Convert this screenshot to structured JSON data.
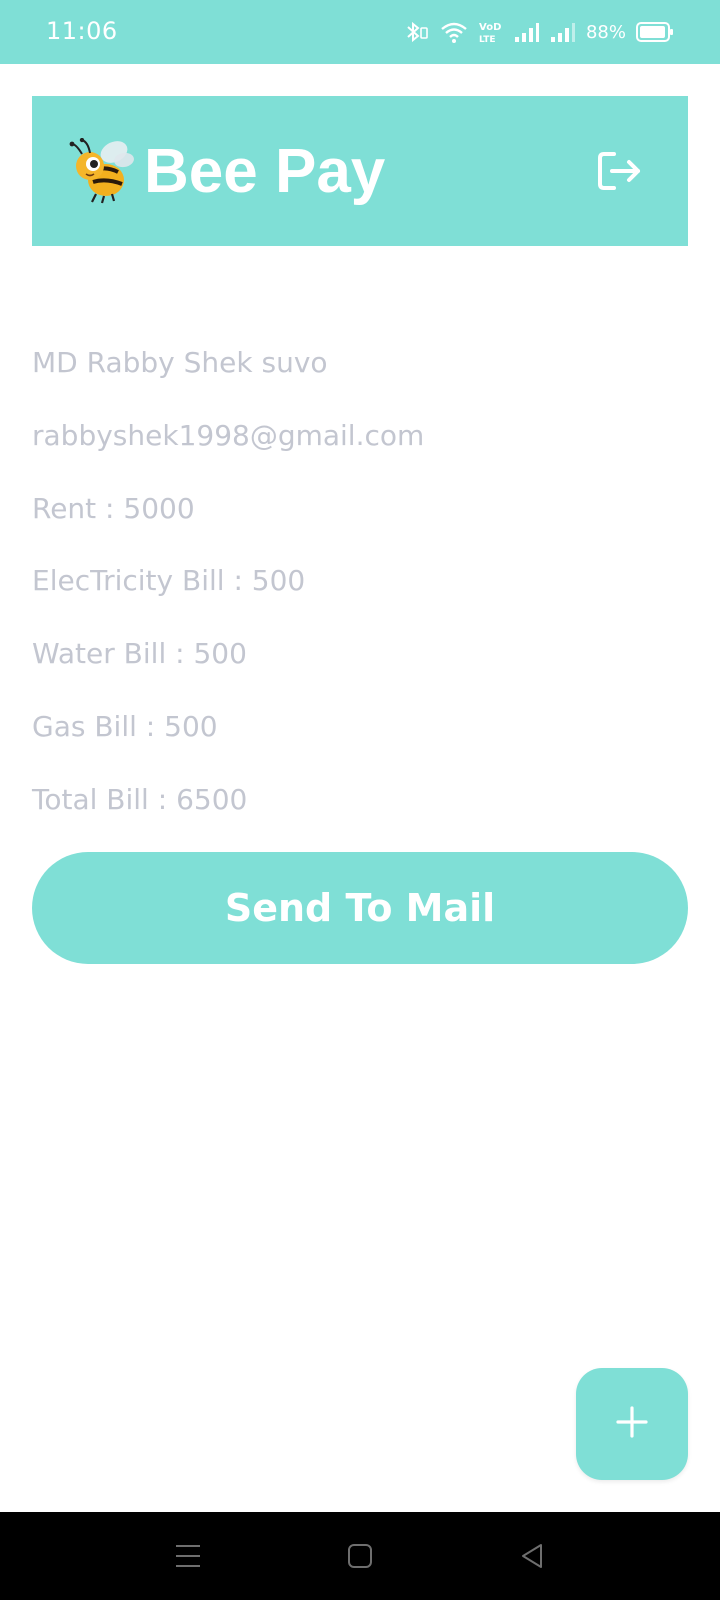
{
  "status_bar": {
    "time": "11:06",
    "battery": "88%",
    "icons": [
      "bluetooth-icon",
      "wifi-icon",
      "volte-icon",
      "signal-1-icon",
      "signal-2-icon",
      "battery-icon"
    ]
  },
  "header": {
    "title": "Bee Pay",
    "logo_icon": "bee-icon",
    "logout_icon": "logout-icon"
  },
  "user": {
    "name": "MD Rabby Shek suvo",
    "email": "rabbyshek1998@gmail.com"
  },
  "bills": {
    "rent": "Rent : 5000",
    "electricity": "ElecTricity Bill : 500",
    "water": "Water Bill : 500",
    "gas": "Gas Bill : 500",
    "total": "Total Bill : 6500"
  },
  "actions": {
    "send_label": "Send To Mail",
    "fab_icon": "plus-icon"
  },
  "nav": {
    "icons": [
      "menu-icon",
      "home-icon",
      "back-icon"
    ]
  },
  "colors": {
    "accent": "#7fdfd6",
    "text_muted": "#c3c6d0",
    "nav_bar": "#000000"
  }
}
